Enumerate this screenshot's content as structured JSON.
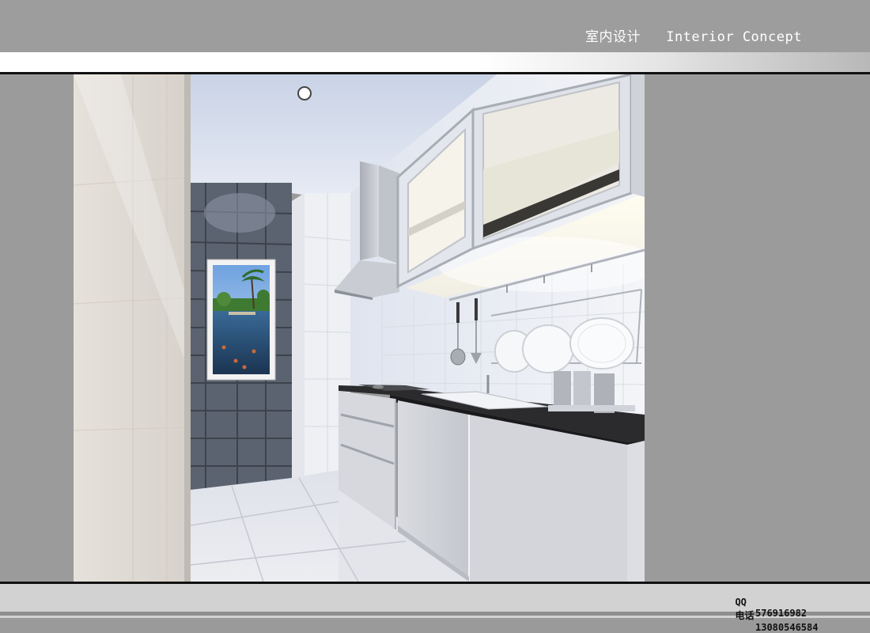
{
  "header": {
    "title": "室内设计   Interior Concept"
  },
  "contact": {
    "qq_label": "QQ",
    "qq_value": "576916982",
    "phone_label": "电话",
    "phone_value": "13080546584"
  },
  "colors": {
    "header_bg": "#9d9d9d",
    "frame_gray": "#9b9b9b",
    "footer_bg": "#d2d2d2"
  }
}
